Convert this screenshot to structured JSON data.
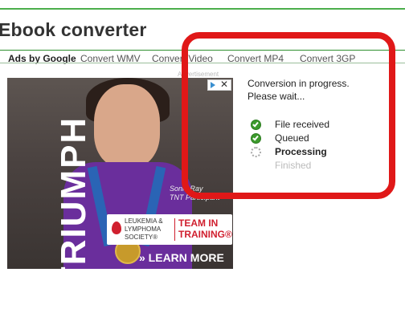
{
  "page": {
    "title": "Ebook converter"
  },
  "ad_links": {
    "ads_label": "Ads by Google",
    "links": [
      "Convert WMV",
      "Convert Video",
      "Convert MP4",
      "Convert 3GP"
    ]
  },
  "ad_banner": {
    "tiny_label": "Advertisement",
    "brand": "TRIUMPH",
    "credit": "Sonia Ray\nTNT Participant",
    "org_name": "LEUKEMIA &\nLYMPHOMA\nSOCIETY®",
    "team": "TEAM IN\nTRAINING®",
    "cta": "» LEARN MORE",
    "choices_icon": "adchoices-icon",
    "close_icon": "close-icon"
  },
  "conversion": {
    "message": "Conversion in progress.\nPlease wait...",
    "steps": [
      {
        "label": "File received",
        "state": "done",
        "icon": "check-circle-icon"
      },
      {
        "label": "Queued",
        "state": "done",
        "icon": "check-circle-icon"
      },
      {
        "label": "Processing",
        "state": "active",
        "icon": "spinner-icon"
      },
      {
        "label": "Finished",
        "state": "pending",
        "icon": ""
      }
    ]
  },
  "colors": {
    "accent_green": "#4cae4c",
    "highlight_red": "#e01818",
    "check_green": "#3c9a2c"
  }
}
